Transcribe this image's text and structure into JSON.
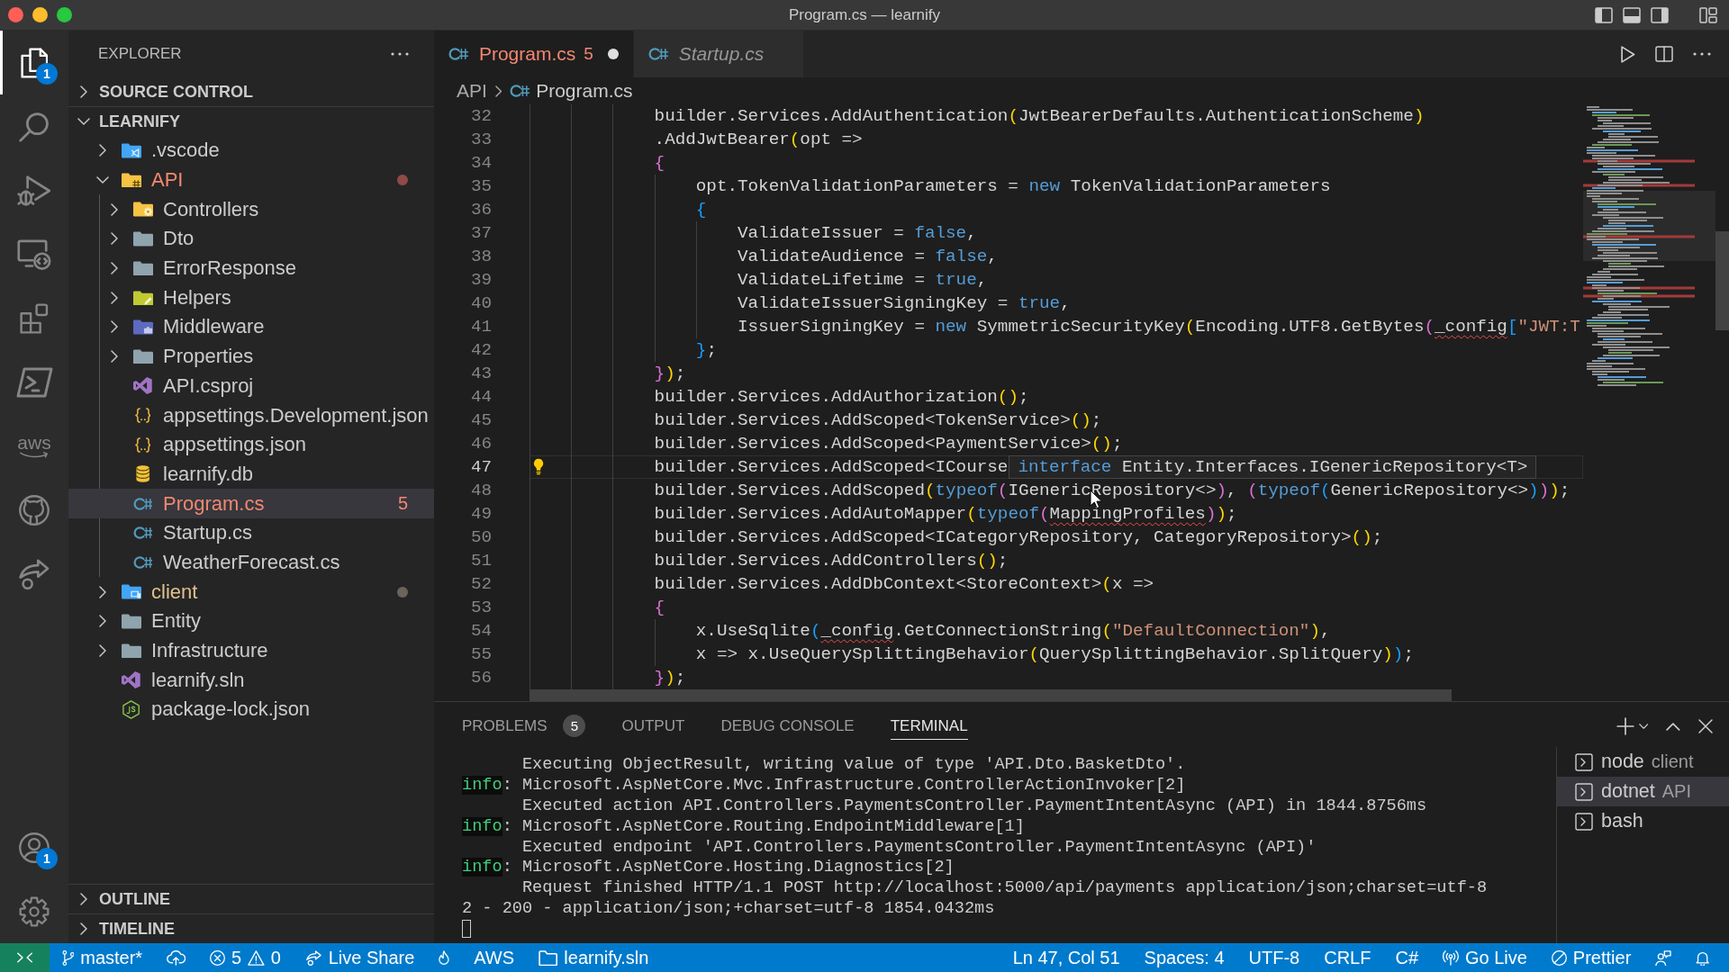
{
  "window": {
    "title": "Program.cs — learnify"
  },
  "activity_bar": {
    "top": [
      {
        "kind": "files",
        "selected": true,
        "badge": "1"
      },
      {
        "kind": "search",
        "selected": false
      },
      {
        "kind": "debug",
        "selected": false
      },
      {
        "kind": "remote",
        "selected": false
      },
      {
        "kind": "extensions",
        "selected": false
      },
      {
        "kind": "terminal",
        "selected": false
      },
      {
        "kind": "aws",
        "label": "aws",
        "selected": false
      },
      {
        "kind": "github",
        "selected": false
      },
      {
        "kind": "liveshare",
        "selected": false
      }
    ],
    "bottom": [
      {
        "kind": "account",
        "badge": "1",
        "selected": false
      },
      {
        "kind": "settings",
        "selected": false
      }
    ]
  },
  "sidebar": {
    "title": "EXPLORER",
    "sections": [
      {
        "title": "SOURCE CONTROL",
        "expanded": false
      },
      {
        "title": "LEARNIFY",
        "expanded": true,
        "items": [
          {
            "name": ".vscode",
            "kind": "vscodefolder",
            "errors": false,
            "modified": false,
            "expanded": false,
            "selected": false
          },
          {
            "name": "API",
            "kind": "hashfolder",
            "errors": true,
            "modified": false,
            "expanded": true,
            "selected": false,
            "children": [
              {
                "name": "Controllers",
                "kind": "gearfolder",
                "errors": false,
                "modified": false,
                "expanded": false,
                "selected": false
              },
              {
                "name": "Dto",
                "kind": "folder",
                "errors": false,
                "modified": false,
                "expanded": false,
                "selected": false
              },
              {
                "name": "ErrorResponse",
                "kind": "folder",
                "errors": false,
                "modified": false,
                "expanded": false,
                "selected": false
              },
              {
                "name": "Helpers",
                "kind": "penfolder",
                "errors": false,
                "modified": false,
                "expanded": false,
                "selected": false
              },
              {
                "name": "Middleware",
                "kind": "puzzlefolder",
                "errors": false,
                "modified": false,
                "expanded": false,
                "selected": false
              },
              {
                "name": "Properties",
                "kind": "folder",
                "errors": false,
                "modified": false,
                "expanded": false,
                "selected": false
              },
              {
                "name": "API.csproj",
                "kind": "vsproject",
                "errors": false,
                "modified": false,
                "selected": false
              },
              {
                "name": "appsettings.Development.json",
                "kind": "json",
                "errors": false,
                "modified": false,
                "selected": false
              },
              {
                "name": "appsettings.json",
                "kind": "json",
                "errors": false,
                "modified": false,
                "selected": false
              },
              {
                "name": "learnify.db",
                "kind": "database",
                "errors": false,
                "modified": false,
                "selected": false
              },
              {
                "name": "Program.cs",
                "kind": "csharp",
                "errors": true,
                "modified": false,
                "problems": "5",
                "selected": true
              },
              {
                "name": "Startup.cs",
                "kind": "csharp",
                "errors": false,
                "modified": false,
                "selected": false
              },
              {
                "name": "WeatherForecast.cs",
                "kind": "csharp",
                "errors": false,
                "modified": false,
                "selected": false
              }
            ]
          },
          {
            "name": "client",
            "kind": "devicefolder",
            "errors": false,
            "modified": true,
            "expanded": false,
            "selected": false
          },
          {
            "name": "Entity",
            "kind": "folder",
            "errors": false,
            "modified": false,
            "expanded": false,
            "selected": false
          },
          {
            "name": "Infrastructure",
            "kind": "folder",
            "errors": false,
            "modified": false,
            "expanded": false,
            "selected": false
          },
          {
            "name": "learnify.sln",
            "kind": "vsproject",
            "errors": false,
            "modified": false,
            "selected": false
          },
          {
            "name": "package-lock.json",
            "kind": "nodejs",
            "errors": false,
            "modified": false,
            "selected": false
          }
        ]
      },
      {
        "title": "OUTLINE",
        "expanded": false
      },
      {
        "title": "TIMELINE",
        "expanded": false
      }
    ]
  },
  "editor": {
    "tabs": [
      {
        "label": "Program.cs",
        "kind": "csharp",
        "errors": true,
        "problems": "5",
        "dirty": true,
        "preview": false,
        "selected": true
      },
      {
        "label": "Startup.cs",
        "kind": "csharp",
        "errors": false,
        "dirty": false,
        "preview": true,
        "selected": false
      }
    ],
    "breadcrumb": [
      {
        "label": "API"
      },
      {
        "label": "Program.cs",
        "kind": "csharp"
      }
    ],
    "lightbulb": true,
    "mouse_pointer": true,
    "lines": [
      {
        "number": "32",
        "current": false,
        "tokens": [
          {
            "text": "            builder.Services.AddAuthentication",
            "kind": "plain"
          },
          {
            "text": "(",
            "kind": "bracket1"
          },
          {
            "text": "JwtBearerDefaults.AuthenticationScheme",
            "kind": "plain"
          },
          {
            "text": ")",
            "kind": "bracket1"
          }
        ]
      },
      {
        "number": "33",
        "current": false,
        "tokens": [
          {
            "text": "            .AddJwtBearer",
            "kind": "plain"
          },
          {
            "text": "(",
            "kind": "bracket1"
          },
          {
            "text": "opt =>",
            "kind": "plain"
          }
        ]
      },
      {
        "number": "34",
        "current": false,
        "tokens": [
          {
            "text": "            {",
            "kind": "bracket2"
          }
        ]
      },
      {
        "number": "35",
        "current": false,
        "tokens": [
          {
            "text": "                opt.TokenValidationParameters = ",
            "kind": "plain"
          },
          {
            "text": "new",
            "kind": "keyword"
          },
          {
            "text": " TokenValidationParameters",
            "kind": "plain"
          }
        ]
      },
      {
        "number": "36",
        "current": false,
        "tokens": [
          {
            "text": "                {",
            "kind": "bracket3"
          }
        ]
      },
      {
        "number": "37",
        "current": false,
        "tokens": [
          {
            "text": "                    ValidateIssuer = ",
            "kind": "plain"
          },
          {
            "text": "false",
            "kind": "keyword"
          },
          {
            "text": ",",
            "kind": "plain"
          }
        ]
      },
      {
        "number": "38",
        "current": false,
        "tokens": [
          {
            "text": "                    ValidateAudience = ",
            "kind": "plain"
          },
          {
            "text": "false",
            "kind": "keyword"
          },
          {
            "text": ",",
            "kind": "plain"
          }
        ]
      },
      {
        "number": "39",
        "current": false,
        "tokens": [
          {
            "text": "                    ValidateLifetime = ",
            "kind": "plain"
          },
          {
            "text": "true",
            "kind": "keyword"
          },
          {
            "text": ",",
            "kind": "plain"
          }
        ]
      },
      {
        "number": "40",
        "current": false,
        "tokens": [
          {
            "text": "                    ValidateIssuerSigningKey = ",
            "kind": "plain"
          },
          {
            "text": "true",
            "kind": "keyword"
          },
          {
            "text": ",",
            "kind": "plain"
          }
        ]
      },
      {
        "number": "41",
        "current": false,
        "tokens": [
          {
            "text": "                    IssuerSigningKey = ",
            "kind": "plain"
          },
          {
            "text": "new",
            "kind": "keyword"
          },
          {
            "text": " SymmetricSecurityKey",
            "kind": "plain"
          },
          {
            "text": "(",
            "kind": "bracket1"
          },
          {
            "text": "Encoding.UTF8.GetBytes",
            "kind": "plain"
          },
          {
            "text": "(",
            "kind": "bracket2"
          },
          {
            "text": "_config",
            "kind": "error"
          },
          {
            "text": "[",
            "kind": "bracket3"
          },
          {
            "text": "\"JWT:T",
            "kind": "string"
          }
        ]
      },
      {
        "number": "42",
        "current": false,
        "tokens": [
          {
            "text": "                }",
            "kind": "bracket3"
          },
          {
            "text": ";",
            "kind": "plain"
          }
        ]
      },
      {
        "number": "43",
        "current": false,
        "tokens": [
          {
            "text": "            }",
            "kind": "bracket2"
          },
          {
            "text": ")",
            "kind": "bracket1"
          },
          {
            "text": ";",
            "kind": "plain"
          }
        ]
      },
      {
        "number": "44",
        "current": false,
        "tokens": [
          {
            "text": "            builder.Services.AddAuthorization",
            "kind": "plain"
          },
          {
            "text": "()",
            "kind": "bracket1"
          },
          {
            "text": ";",
            "kind": "plain"
          }
        ]
      },
      {
        "number": "45",
        "current": false,
        "tokens": [
          {
            "text": "            builder.Services.AddScoped<TokenService>",
            "kind": "plain"
          },
          {
            "text": "()",
            "kind": "bracket1"
          },
          {
            "text": ";",
            "kind": "plain"
          }
        ]
      },
      {
        "number": "46",
        "current": false,
        "tokens": [
          {
            "text": "            builder.Services.AddScoped<PaymentService>",
            "kind": "plain"
          },
          {
            "text": "()",
            "kind": "bracket1"
          },
          {
            "text": ";",
            "kind": "plain"
          }
        ]
      },
      {
        "number": "47",
        "current": true,
        "tokens": [
          {
            "text": "            builder.Services.AddScoped<ICourse",
            "kind": "plain"
          }
        ],
        "hover": {
          "tokens": [
            {
              "text": "interface",
              "kind": "keyword"
            },
            {
              "text": " Entity.Interfaces.IGenericRepository<T>",
              "kind": "plain"
            }
          ]
        }
      },
      {
        "number": "48",
        "current": false,
        "tokens": [
          {
            "text": "            builder.Services.AddScoped",
            "kind": "plain"
          },
          {
            "text": "(",
            "kind": "bracket1"
          },
          {
            "text": "typeof",
            "kind": "keyword"
          },
          {
            "text": "(",
            "kind": "bracket2"
          },
          {
            "text": "IGenericRepository<>",
            "kind": "plain"
          },
          {
            "text": ")",
            "kind": "bracket2"
          },
          {
            "text": ", ",
            "kind": "plain"
          },
          {
            "text": "(",
            "kind": "bracket2"
          },
          {
            "text": "typeof",
            "kind": "keyword"
          },
          {
            "text": "(",
            "kind": "bracket3"
          },
          {
            "text": "GenericRepository<>",
            "kind": "plain"
          },
          {
            "text": ")",
            "kind": "bracket3"
          },
          {
            "text": ")",
            "kind": "bracket2"
          },
          {
            "text": ")",
            "kind": "bracket1"
          },
          {
            "text": ";",
            "kind": "plain"
          }
        ]
      },
      {
        "number": "49",
        "current": false,
        "tokens": [
          {
            "text": "            builder.Services.AddAutoMapper",
            "kind": "plain"
          },
          {
            "text": "(",
            "kind": "bracket1"
          },
          {
            "text": "typeof",
            "kind": "keyword"
          },
          {
            "text": "(",
            "kind": "bracket2"
          },
          {
            "text": "MappingProfiles",
            "kind": "error"
          },
          {
            "text": ")",
            "kind": "bracket2"
          },
          {
            "text": ")",
            "kind": "bracket1"
          },
          {
            "text": ";",
            "kind": "plain"
          }
        ]
      },
      {
        "number": "50",
        "current": false,
        "tokens": [
          {
            "text": "            builder.Services.AddScoped<ICategoryRepository, CategoryRepository>",
            "kind": "plain"
          },
          {
            "text": "()",
            "kind": "bracket1"
          },
          {
            "text": ";",
            "kind": "plain"
          }
        ]
      },
      {
        "number": "51",
        "current": false,
        "tokens": [
          {
            "text": "            builder.Services.AddControllers",
            "kind": "plain"
          },
          {
            "text": "()",
            "kind": "bracket1"
          },
          {
            "text": ";",
            "kind": "plain"
          }
        ]
      },
      {
        "number": "52",
        "current": false,
        "tokens": [
          {
            "text": "            builder.Services.AddDbContext<StoreContext>",
            "kind": "plain"
          },
          {
            "text": "(",
            "kind": "bracket1"
          },
          {
            "text": "x =>",
            "kind": "plain"
          }
        ]
      },
      {
        "number": "53",
        "current": false,
        "tokens": [
          {
            "text": "            {",
            "kind": "bracket2"
          }
        ]
      },
      {
        "number": "54",
        "current": false,
        "tokens": [
          {
            "text": "                x.UseSqlite",
            "kind": "plain"
          },
          {
            "text": "(",
            "kind": "bracket3"
          },
          {
            "text": "_config",
            "kind": "error"
          },
          {
            "text": ".GetConnectionString",
            "kind": "plain"
          },
          {
            "text": "(",
            "kind": "bracket1"
          },
          {
            "text": "\"DefaultConnection\"",
            "kind": "string"
          },
          {
            "text": ")",
            "kind": "bracket1"
          },
          {
            "text": ",",
            "kind": "plain"
          }
        ]
      },
      {
        "number": "55",
        "current": false,
        "tokens": [
          {
            "text": "                x => x.UseQuerySplittingBehavior",
            "kind": "plain"
          },
          {
            "text": "(",
            "kind": "bracket1"
          },
          {
            "text": "QuerySplittingBehavior.SplitQuery",
            "kind": "plain"
          },
          {
            "text": ")",
            "kind": "bracket1"
          },
          {
            "text": ")",
            "kind": "bracket3"
          },
          {
            "text": ";",
            "kind": "plain"
          }
        ]
      },
      {
        "number": "56",
        "current": false,
        "tokens": [
          {
            "text": "            }",
            "kind": "bracket2"
          },
          {
            "text": ")",
            "kind": "bracket1"
          },
          {
            "text": ";",
            "kind": "plain"
          }
        ]
      }
    ]
  },
  "panel": {
    "tabs": [
      {
        "label": "PROBLEMS",
        "badge": "5",
        "selected": false
      },
      {
        "label": "OUTPUT",
        "selected": false
      },
      {
        "label": "DEBUG CONSOLE",
        "selected": false
      },
      {
        "label": "TERMINAL",
        "selected": true
      }
    ],
    "terminal": {
      "cursor": true,
      "lines": [
        {
          "text": "      Executing ObjectResult, writing value of type 'API.Dto.BasketDto'."
        },
        {
          "level": "info",
          "text": ": Microsoft.AspNetCore.Mvc.Infrastructure.ControllerActionInvoker[2]"
        },
        {
          "text": "      Executed action API.Controllers.PaymentsController.PaymentIntentAsync (API) in 1844.8756ms"
        },
        {
          "level": "info",
          "text": ": Microsoft.AspNetCore.Routing.EndpointMiddleware[1]"
        },
        {
          "text": "      Executed endpoint 'API.Controllers.PaymentsController.PaymentIntentAsync (API)'"
        },
        {
          "level": "info",
          "text": ": Microsoft.AspNetCore.Hosting.Diagnostics[2]"
        },
        {
          "text": "      Request finished HTTP/1.1 POST http://localhost:5000/api/payments application/json;charset=utf-8"
        },
        {
          "text": "2 - 200 - application/json;+charset=utf-8 1854.0432ms"
        }
      ]
    },
    "sessions": [
      {
        "name": "node",
        "detail": "client",
        "selected": false
      },
      {
        "name": "dotnet",
        "detail": "API",
        "selected": true
      },
      {
        "name": "bash",
        "selected": false
      }
    ]
  },
  "status_bar": {
    "left": [
      {
        "kind": "remote"
      },
      {
        "kind": "branch",
        "label": "master*"
      },
      {
        "kind": "sync"
      },
      {
        "kind": "problems",
        "errors": "5",
        "warnings": "0"
      },
      {
        "kind": "liveshare",
        "label": "Live Share"
      },
      {
        "kind": "flame"
      },
      {
        "kind": "text",
        "label": "AWS"
      },
      {
        "kind": "folder",
        "label": "learnify.sln"
      }
    ],
    "right": [
      {
        "kind": "text",
        "label": "Ln 47, Col 51"
      },
      {
        "kind": "text",
        "label": "Spaces: 4"
      },
      {
        "kind": "text",
        "label": "UTF-8"
      },
      {
        "kind": "text",
        "label": "CRLF"
      },
      {
        "kind": "text",
        "label": "C#"
      },
      {
        "kind": "broadcast",
        "label": "Go Live"
      },
      {
        "kind": "blocked",
        "label": "Prettier"
      },
      {
        "kind": "feedback"
      },
      {
        "kind": "bell"
      }
    ]
  }
}
